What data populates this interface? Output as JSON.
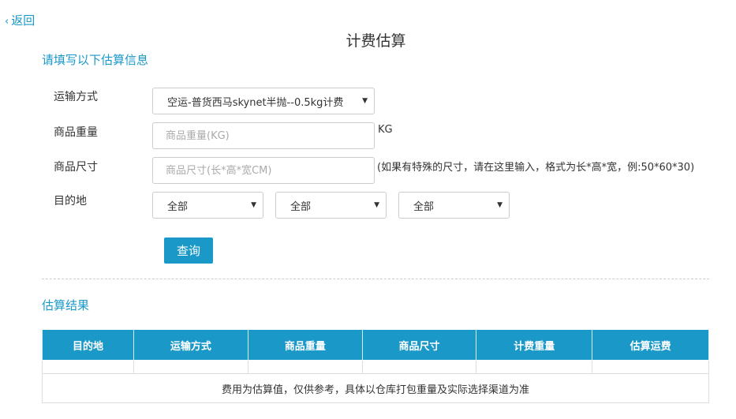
{
  "back": {
    "label": "返回"
  },
  "page_title": "计费估算",
  "form": {
    "section_title": "请填写以下估算信息",
    "shipping_method": {
      "label": "运输方式",
      "value": "空运-普货西马skynet半抛--0.5kg计费"
    },
    "weight": {
      "label": "商品重量",
      "placeholder": "商品重量(KG)",
      "unit": "KG"
    },
    "size": {
      "label": "商品尺寸",
      "placeholder": "商品尺寸(长*高*宽CM)",
      "hint": "(如果有特殊的尺寸，请在这里输入，格式为长*高*宽，例:50*60*30)"
    },
    "destination": {
      "label": "目的地",
      "selects": [
        "全部",
        "全部",
        "全部"
      ]
    },
    "query_button": "查询"
  },
  "result": {
    "section_title": "估算结果",
    "columns": [
      "目的地",
      "运输方式",
      "商品重量",
      "商品尺寸",
      "计费重量",
      "估算运费"
    ],
    "note": "费用为估算值，仅供参考，具体以仓库打包重量及实际选择渠道为准"
  },
  "colors": {
    "accent": "#1a98c8"
  }
}
